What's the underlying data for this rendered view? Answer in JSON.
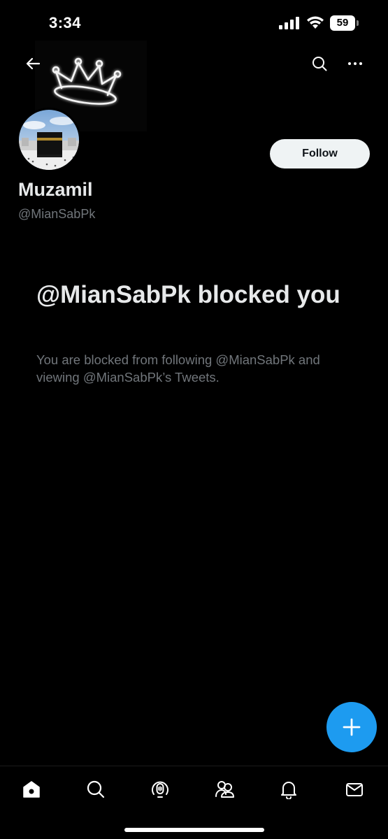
{
  "status_bar": {
    "time": "3:34",
    "battery": "59",
    "icons": [
      "signal-icon",
      "wifi-icon",
      "battery-icon"
    ]
  },
  "header": {
    "icons": [
      "back-arrow-icon",
      "crown-icon",
      "search-icon",
      "more-icon"
    ]
  },
  "profile": {
    "display_name": "Muzamil",
    "handle": "@MianSabPk",
    "follow_label": "Follow"
  },
  "blocked": {
    "title": "@MianSabPk blocked you",
    "description": "You are blocked from following @MianSabPk and viewing @MianSabPk’s Tweets."
  },
  "fab": {
    "icon": "plus-icon"
  },
  "bottom_nav": {
    "items": [
      "home-icon",
      "search-icon",
      "spaces-icon",
      "communities-icon",
      "notifications-icon",
      "messages-icon"
    ]
  },
  "colors": {
    "background": "#000000",
    "accent": "#1d9bf0",
    "primary_text": "#e7e9ea",
    "secondary_text": "#71767b",
    "follow_button_bg": "#eff3f4"
  }
}
